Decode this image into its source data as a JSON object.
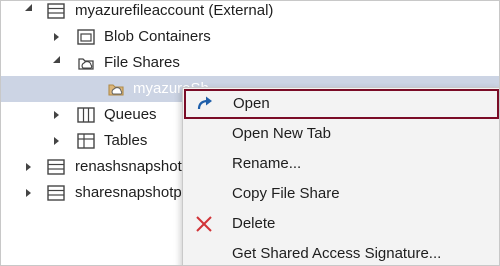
{
  "tree": {
    "account_label": "myazurefileaccount (External)",
    "blob_containers": "Blob Containers",
    "file_shares": "File Shares",
    "share_item": "myazureSh",
    "queues": "Queues",
    "tables": "Tables",
    "snapshot_1": "renashsnapshot",
    "snapshot_2": "sharesnapshotpe"
  },
  "context_menu": {
    "open": "Open",
    "open_new_tab": "Open New Tab",
    "rename": "Rename...",
    "copy_file_share": "Copy File Share",
    "delete": "Delete",
    "get_sas": "Get Shared Access Signature..."
  },
  "colors": {
    "selection_bg": "#ccd4e4",
    "focus_border": "#7a0c26",
    "open_icon": "#1f5faa",
    "delete_icon": "#d13438",
    "share_icon": "#dcb67a"
  },
  "icons": {
    "account": "storage-account-icon",
    "blob": "blob-container-icon",
    "file_shares": "file-share-icon",
    "queues": "queue-icon",
    "tables": "table-icon",
    "open": "open-arrow-icon",
    "delete": "delete-x-icon"
  }
}
